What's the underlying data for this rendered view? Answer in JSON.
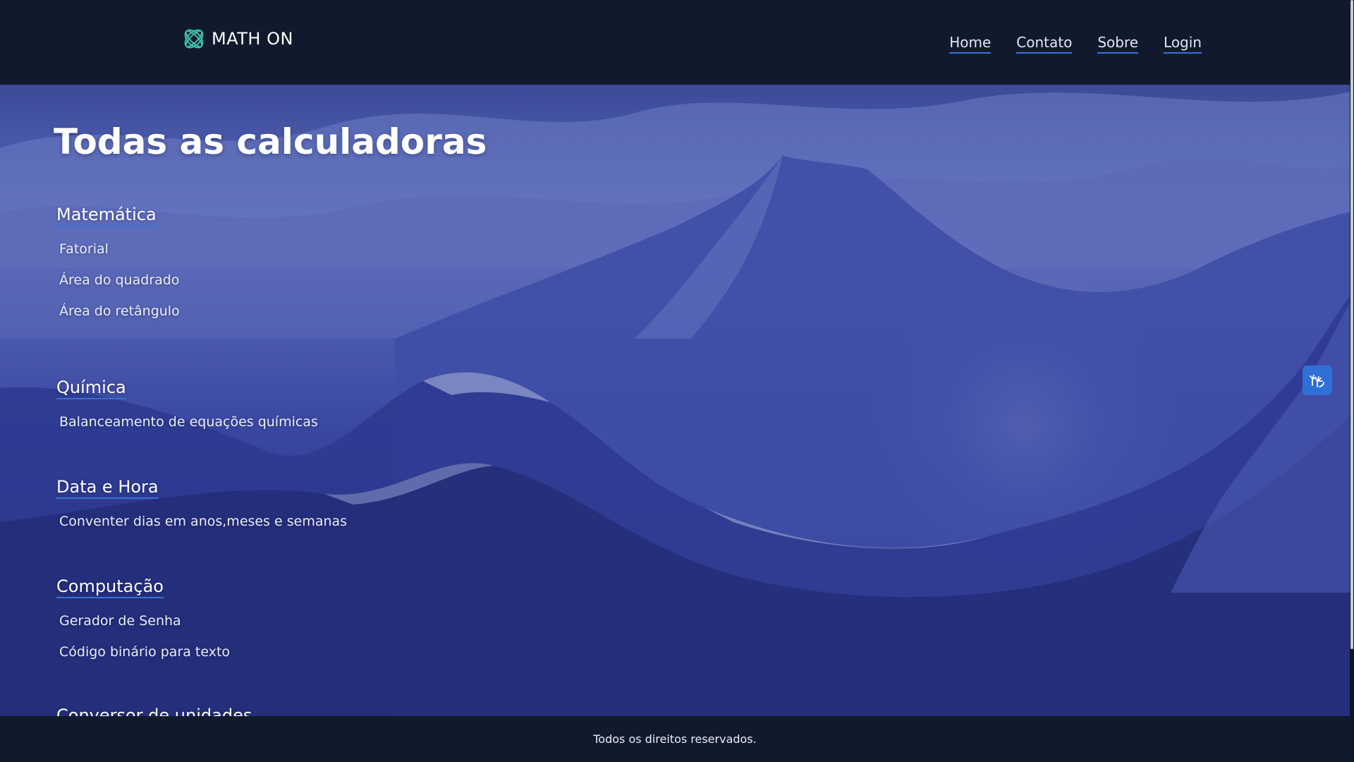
{
  "header": {
    "logo_text": "MATH ON",
    "nav": [
      {
        "label": "Home"
      },
      {
        "label": "Contato"
      },
      {
        "label": "Sobre"
      },
      {
        "label": "Login"
      }
    ]
  },
  "main": {
    "title": "Todas as calculadoras",
    "categories": [
      {
        "title": "Matemática",
        "items": [
          "Fatorial",
          "Área do quadrado",
          "Área do retângulo"
        ]
      },
      {
        "title": "Química",
        "items": [
          "Balanceamento de equações químicas"
        ]
      },
      {
        "title": "Data e Hora",
        "items": [
          "Conventer dias em anos,meses e semanas"
        ]
      },
      {
        "title": "Computação",
        "items": [
          "Gerador de Senha",
          "Código binário para texto"
        ]
      },
      {
        "title": "Conversor de unidades",
        "items": []
      }
    ]
  },
  "accessibility": {
    "icon": "sign-language-hands-icon",
    "accent": "#2f6fd8"
  },
  "footer": {
    "text": "Todos os direitos reservados."
  },
  "colors": {
    "header_bg": "#111a2d",
    "link_underline": "#3b71d1",
    "logo_accent": "#3fc2a8"
  }
}
